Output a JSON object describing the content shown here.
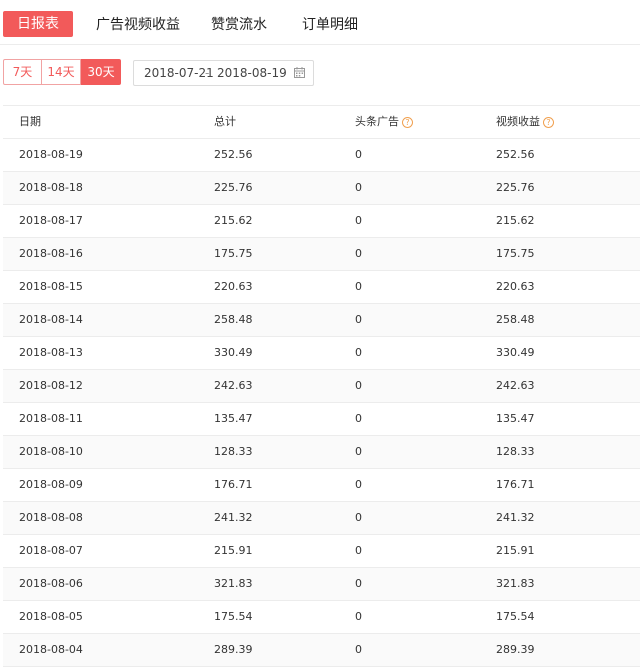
{
  "tabs": [
    {
      "label": "日报表",
      "active": true
    },
    {
      "label": "广告视频收益",
      "active": false
    },
    {
      "label": "赞赏流水",
      "active": false
    },
    {
      "label": "订单明细",
      "active": false
    }
  ],
  "range_buttons": {
    "b7": "7天",
    "b14": "14天",
    "b30": "30天",
    "selected": "30天"
  },
  "date_range": {
    "start": "2018-07-21",
    "separator": "-",
    "end": "2018-08-19"
  },
  "table": {
    "headers": {
      "date": "日期",
      "total": "总计",
      "headline_ads": "头条广告",
      "video_income": "视频收益"
    },
    "rows": [
      {
        "date": "2018-08-19",
        "total": "252.56",
        "ads": "0",
        "video": "252.56"
      },
      {
        "date": "2018-08-18",
        "total": "225.76",
        "ads": "0",
        "video": "225.76"
      },
      {
        "date": "2018-08-17",
        "total": "215.62",
        "ads": "0",
        "video": "215.62"
      },
      {
        "date": "2018-08-16",
        "total": "175.75",
        "ads": "0",
        "video": "175.75"
      },
      {
        "date": "2018-08-15",
        "total": "220.63",
        "ads": "0",
        "video": "220.63"
      },
      {
        "date": "2018-08-14",
        "total": "258.48",
        "ads": "0",
        "video": "258.48"
      },
      {
        "date": "2018-08-13",
        "total": "330.49",
        "ads": "0",
        "video": "330.49"
      },
      {
        "date": "2018-08-12",
        "total": "242.63",
        "ads": "0",
        "video": "242.63"
      },
      {
        "date": "2018-08-11",
        "total": "135.47",
        "ads": "0",
        "video": "135.47"
      },
      {
        "date": "2018-08-10",
        "total": "128.33",
        "ads": "0",
        "video": "128.33"
      },
      {
        "date": "2018-08-09",
        "total": "176.71",
        "ads": "0",
        "video": "176.71"
      },
      {
        "date": "2018-08-08",
        "total": "241.32",
        "ads": "0",
        "video": "241.32"
      },
      {
        "date": "2018-08-07",
        "total": "215.91",
        "ads": "0",
        "video": "215.91"
      },
      {
        "date": "2018-08-06",
        "total": "321.83",
        "ads": "0",
        "video": "321.83"
      },
      {
        "date": "2018-08-05",
        "total": "175.54",
        "ads": "0",
        "video": "175.54"
      },
      {
        "date": "2018-08-04",
        "total": "289.39",
        "ads": "0",
        "video": "289.39"
      }
    ]
  },
  "colors": {
    "accent": "#f25a5a",
    "help": "#f0a050"
  },
  "icons": {
    "calendar": "calendar-icon",
    "help": "help-circle-icon"
  }
}
